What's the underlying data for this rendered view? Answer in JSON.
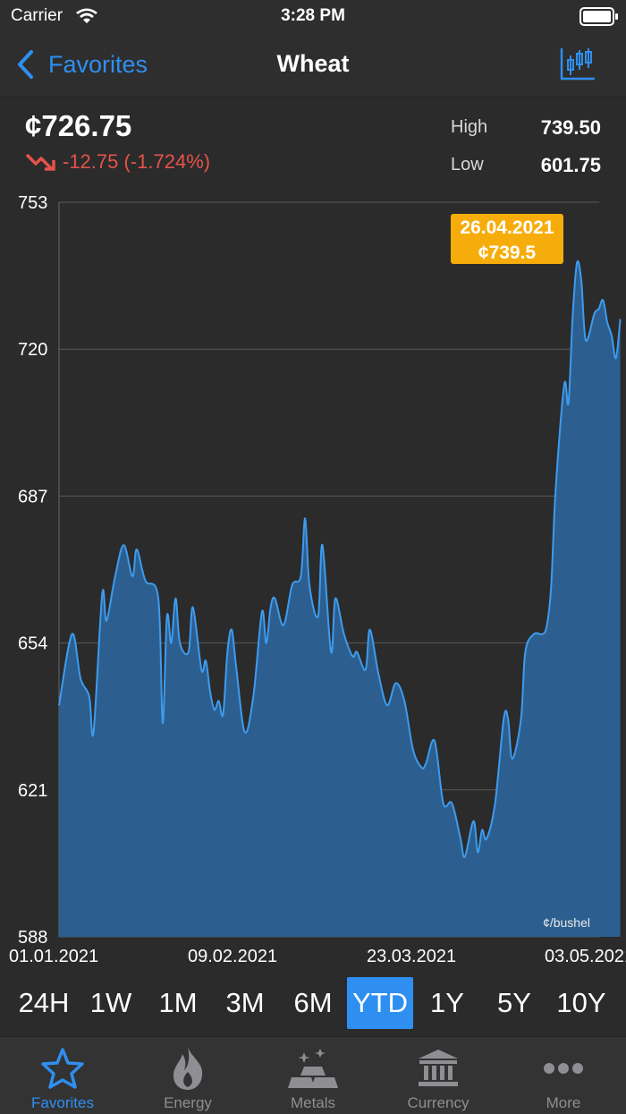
{
  "status_bar": {
    "carrier": "Carrier",
    "time": "3:28 PM"
  },
  "nav": {
    "back_label": "Favorites",
    "title": "Wheat",
    "chart_icon": "candlestick-chart-icon"
  },
  "quote": {
    "price": "¢726.75",
    "change": "-12.75 (-1.724%)",
    "high_label": "High",
    "high_value": "739.50",
    "low_label": "Low",
    "low_value": "601.75",
    "trend_icon": "trend-down-icon",
    "trend_color": "#e5534b"
  },
  "chart_data": {
    "type": "area",
    "x_range": [
      "2021-01-01",
      "2021-05-03"
    ],
    "ylim": [
      588,
      753
    ],
    "y_ticks": [
      "753",
      "720",
      "687",
      "654",
      "621",
      "588"
    ],
    "x_ticks": [
      "01.01.2021",
      "09.02.2021",
      "23.03.2021",
      "03.05.2021"
    ],
    "unit_label": "¢/bushel",
    "tooltip": {
      "date": "26.04.2021",
      "value": "¢739.5"
    },
    "grid": true,
    "line_color": "#3d9bef",
    "fill_color": "#2c5f8f",
    "tooltip_color": "#f6ad0b",
    "points": [
      [
        "2021-01-01",
        640
      ],
      [
        "2021-01-04",
        656
      ],
      [
        "2021-01-06",
        646
      ],
      [
        "2021-01-08",
        642
      ],
      [
        "2021-01-09",
        634
      ],
      [
        "2021-01-11",
        665
      ],
      [
        "2021-01-12",
        659
      ],
      [
        "2021-01-14",
        669
      ],
      [
        "2021-01-16",
        676
      ],
      [
        "2021-01-18",
        669
      ],
      [
        "2021-01-19",
        675
      ],
      [
        "2021-01-21",
        668
      ],
      [
        "2021-01-24",
        664
      ],
      [
        "2021-01-25",
        636
      ],
      [
        "2021-01-26",
        660
      ],
      [
        "2021-01-27",
        654
      ],
      [
        "2021-01-28",
        664
      ],
      [
        "2021-01-29",
        654
      ],
      [
        "2021-01-31",
        652
      ],
      [
        "2021-02-01",
        662
      ],
      [
        "2021-02-03",
        648
      ],
      [
        "2021-02-04",
        650
      ],
      [
        "2021-02-05",
        643
      ],
      [
        "2021-02-06",
        639
      ],
      [
        "2021-02-07",
        641
      ],
      [
        "2021-02-08",
        638
      ],
      [
        "2021-02-09",
        652
      ],
      [
        "2021-02-10",
        657
      ],
      [
        "2021-02-11",
        649
      ],
      [
        "2021-02-13",
        634
      ],
      [
        "2021-02-15",
        642
      ],
      [
        "2021-02-17",
        661
      ],
      [
        "2021-02-18",
        654
      ],
      [
        "2021-02-19",
        662
      ],
      [
        "2021-02-20",
        664
      ],
      [
        "2021-02-22",
        658
      ],
      [
        "2021-02-24",
        667
      ],
      [
        "2021-02-26",
        669
      ],
      [
        "2021-02-27",
        682
      ],
      [
        "2021-02-28",
        667
      ],
      [
        "2021-03-02",
        660
      ],
      [
        "2021-03-03",
        676
      ],
      [
        "2021-03-05",
        652
      ],
      [
        "2021-03-06",
        664
      ],
      [
        "2021-03-08",
        656
      ],
      [
        "2021-03-10",
        651
      ],
      [
        "2021-03-11",
        652
      ],
      [
        "2021-03-13",
        648
      ],
      [
        "2021-03-14",
        657
      ],
      [
        "2021-03-16",
        647
      ],
      [
        "2021-03-18",
        640
      ],
      [
        "2021-03-20",
        645
      ],
      [
        "2021-03-22",
        641
      ],
      [
        "2021-03-24",
        630
      ],
      [
        "2021-03-26",
        626
      ],
      [
        "2021-03-27",
        627
      ],
      [
        "2021-03-29",
        632
      ],
      [
        "2021-03-31",
        618
      ],
      [
        "2021-04-02",
        618
      ],
      [
        "2021-04-04",
        610
      ],
      [
        "2021-04-05",
        606
      ],
      [
        "2021-04-07",
        614
      ],
      [
        "2021-04-08",
        607
      ],
      [
        "2021-04-09",
        612
      ],
      [
        "2021-04-10",
        610
      ],
      [
        "2021-04-12",
        618
      ],
      [
        "2021-04-14",
        637
      ],
      [
        "2021-04-15",
        637
      ],
      [
        "2021-04-16",
        628
      ],
      [
        "2021-04-18",
        637
      ],
      [
        "2021-04-19",
        652
      ],
      [
        "2021-04-21",
        656
      ],
      [
        "2021-04-23",
        656
      ],
      [
        "2021-04-24",
        658
      ],
      [
        "2021-04-25",
        667
      ],
      [
        "2021-04-26",
        688
      ],
      [
        "2021-04-28",
        712
      ],
      [
        "2021-04-29",
        708
      ],
      [
        "2021-04-30",
        728
      ],
      [
        "2021-05-01",
        739.5
      ],
      [
        "2021-05-02",
        735
      ],
      [
        "2021-05-03",
        722
      ],
      [
        "2021-05-05",
        728
      ],
      [
        "2021-05-06",
        729
      ],
      [
        "2021-05-07",
        731
      ],
      [
        "2021-05-08",
        726
      ],
      [
        "2021-05-09",
        723
      ],
      [
        "2021-05-10",
        718
      ],
      [
        "2021-05-11",
        726.75
      ]
    ]
  },
  "ranges": {
    "items": [
      "24H",
      "1W",
      "1M",
      "3M",
      "6M",
      "YTD",
      "1Y",
      "5Y",
      "10Y"
    ],
    "active": "YTD"
  },
  "tabs": {
    "items": [
      {
        "label": "Favorites",
        "icon": "star-icon"
      },
      {
        "label": "Energy",
        "icon": "flame-icon"
      },
      {
        "label": "Metals",
        "icon": "gold-bars-icon"
      },
      {
        "label": "Currency",
        "icon": "bank-icon"
      },
      {
        "label": "More",
        "icon": "more-dots-icon"
      }
    ],
    "active": "Favorites"
  },
  "colors": {
    "accent": "#2f8ff0",
    "background": "#2b2b2b",
    "negative": "#e5534b",
    "tab_inactive": "#8e8e93"
  }
}
